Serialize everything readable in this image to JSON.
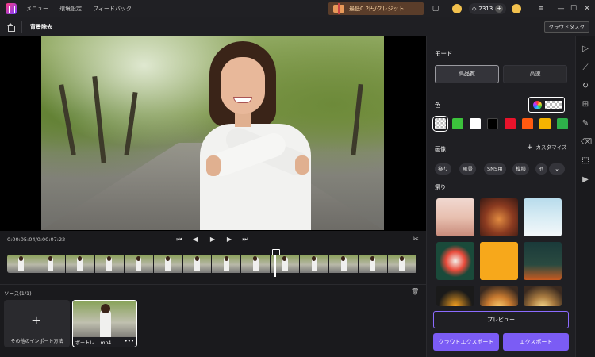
{
  "titlebar": {
    "menu": [
      "メニュー",
      "環境設定",
      "フィードバック"
    ],
    "promo_text": "最低0.2円/クレジット",
    "credits": "2313"
  },
  "subbar": {
    "page_title": "背景除去",
    "cloud_task": "クラウドタスク"
  },
  "playback": {
    "timecode": "0:00:05:04/0:00:07:22"
  },
  "sources": {
    "label": "ソース(1/1)",
    "import_label": "その他のインポート方法",
    "file_name": "ポートレ....mp4"
  },
  "panel": {
    "mode_title": "モード",
    "mode_hq": "高品質",
    "mode_fast": "高速",
    "color_title": "色",
    "swatches": [
      "transparent",
      "#3cc23c",
      "#ffffff",
      "#000000",
      "#e8132b",
      "#ff5a10",
      "#f5b400",
      "#2eb04a"
    ],
    "image_title": "画像",
    "customize": "カスタマイズ",
    "chips": [
      "祭り",
      "風景",
      "SNS用",
      "模様",
      "ゼ"
    ],
    "category": "祭り",
    "preview_btn": "プレビュー",
    "cloud_export_btn": "クラウドエクスポート",
    "export_btn": "エクスポート"
  },
  "colors": {
    "accent": "#7b5cf5"
  },
  "icons": {
    "toolstrip": [
      "play-icon",
      "trend-icon",
      "refresh-icon",
      "grid-icon",
      "edit-icon",
      "eraser-icon",
      "cutout-icon",
      "video-play-icon"
    ]
  }
}
